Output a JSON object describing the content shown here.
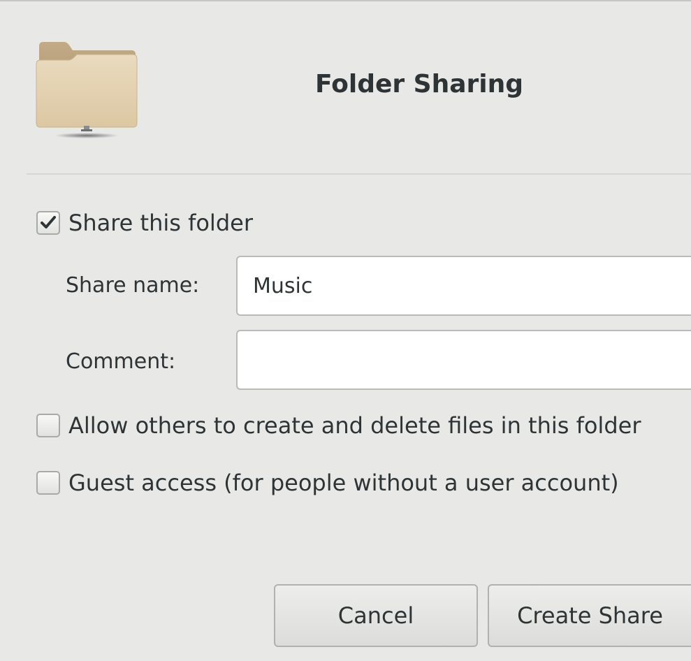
{
  "dialog": {
    "title": "Folder Sharing",
    "icon": "folder-share-icon"
  },
  "share_folder": {
    "label": "Share this folder",
    "checked": true
  },
  "share_name": {
    "label": "Share name:",
    "value": "Music"
  },
  "comment": {
    "label": "Comment:",
    "value": ""
  },
  "allow_others": {
    "label": "Allow others to create and delete files in this folder",
    "checked": false
  },
  "guest_access": {
    "label": "Guest access (for people without a user account)",
    "checked": false
  },
  "buttons": {
    "cancel": "Cancel",
    "create": "Create Share"
  },
  "colors": {
    "background": "#e8e8e7",
    "folder": "#e1cdab",
    "text": "#2e3436"
  }
}
